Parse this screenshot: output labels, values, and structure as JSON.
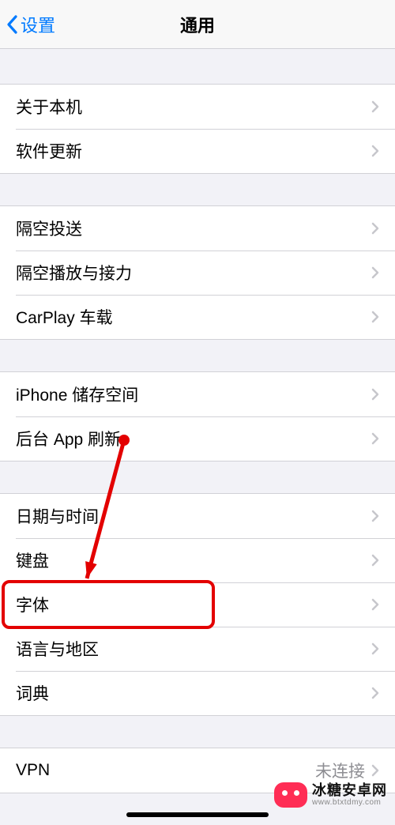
{
  "nav": {
    "back_label": "设置",
    "title": "通用"
  },
  "groups": [
    {
      "items": [
        {
          "key": "about",
          "label": "关于本机"
        },
        {
          "key": "software-update",
          "label": "软件更新"
        }
      ]
    },
    {
      "items": [
        {
          "key": "airdrop",
          "label": "隔空投送"
        },
        {
          "key": "airplay-handoff",
          "label": "隔空播放与接力"
        },
        {
          "key": "carplay",
          "label": "CarPlay 车载"
        }
      ]
    },
    {
      "items": [
        {
          "key": "iphone-storage",
          "label": "iPhone 储存空间"
        },
        {
          "key": "background-app-refresh",
          "label": "后台 App 刷新"
        }
      ]
    },
    {
      "items": [
        {
          "key": "date-time",
          "label": "日期与时间"
        },
        {
          "key": "keyboard",
          "label": "键盘"
        },
        {
          "key": "fonts",
          "label": "字体",
          "highlighted": true
        },
        {
          "key": "language-region",
          "label": "语言与地区"
        },
        {
          "key": "dictionary",
          "label": "词典"
        }
      ]
    },
    {
      "items": [
        {
          "key": "vpn",
          "label": "VPN",
          "detail": "未连接"
        }
      ]
    }
  ],
  "watermark": {
    "name": "冰糖安卓网",
    "url": "www.btxtdmy.com"
  },
  "colors": {
    "accent": "#007aff",
    "annotation": "#e30000"
  }
}
